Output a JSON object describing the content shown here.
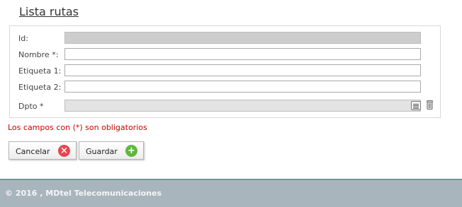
{
  "page": {
    "title": "Lista rutas"
  },
  "form": {
    "fields": [
      {
        "label": "Id:",
        "value": ""
      },
      {
        "label": "Nombre *:",
        "value": ""
      },
      {
        "label": "Etiqueta 1:",
        "value": ""
      },
      {
        "label": "Etiqueta 2:",
        "value": ""
      },
      {
        "label": "Dpto *",
        "value": ""
      }
    ],
    "required_note": "Los campos con (*) son obligatorios"
  },
  "buttons": {
    "cancel_label": "Cancelar",
    "save_label": "Guardar"
  },
  "icons": {
    "cancel": "close-circle-icon",
    "save": "plus-circle-icon",
    "list": "list-icon",
    "trash": "trash-icon"
  },
  "colors": {
    "required_text": "#cc0000",
    "cancel_icon": "#e8464f",
    "save_icon": "#5fb83a",
    "footer_bg": "#a9b5bd"
  },
  "footer": {
    "text": "© 2016 , MDtel Telecomunicaciones"
  }
}
